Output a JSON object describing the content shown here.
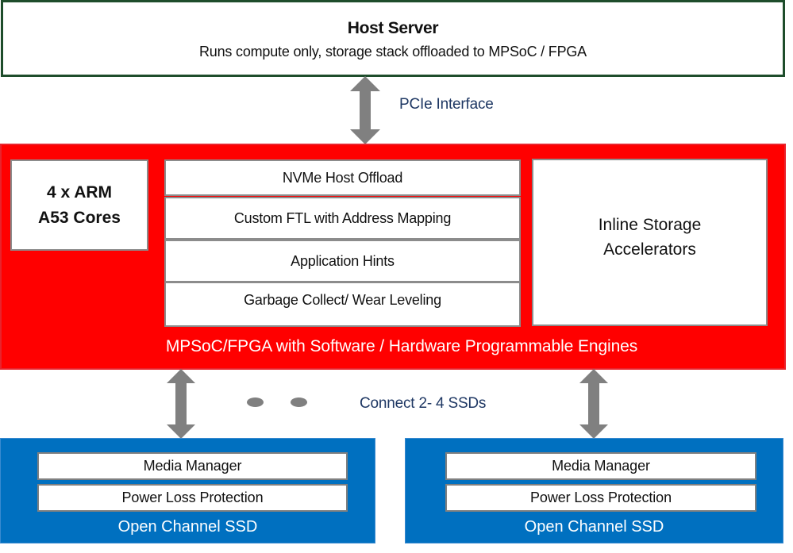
{
  "host": {
    "title": "Host Server",
    "subtitle": "Runs compute only, storage stack offloaded to MPSoC / FPGA"
  },
  "connections": {
    "pcie_label": "PCIe Interface",
    "ssd_label": "Connect 2- 4 SSDs"
  },
  "mpsoc": {
    "arm_cores": [
      "4 x ARM",
      "A53 Cores"
    ],
    "stack": [
      "NVMe Host Offload",
      "Custom FTL with Address Mapping",
      "Application Hints",
      "Garbage Collect/ Wear Leveling"
    ],
    "accelerators": [
      "Inline Storage",
      "Accelerators"
    ],
    "caption": "MPSoC/FPGA with Software / Hardware Programmable Engines"
  },
  "ssds": [
    {
      "rows": [
        "Media Manager",
        "Power Loss Protection"
      ],
      "caption": "Open Channel SSD"
    },
    {
      "rows": [
        "Media Manager",
        "Power Loss Protection"
      ],
      "caption": "Open Channel SSD"
    }
  ],
  "colors": {
    "host_border": "#1e4d2b",
    "mpsoc_fill": "#ff0000",
    "ssd_fill": "#0070c0",
    "arrow": "#808080",
    "label_text": "#1f3864"
  }
}
